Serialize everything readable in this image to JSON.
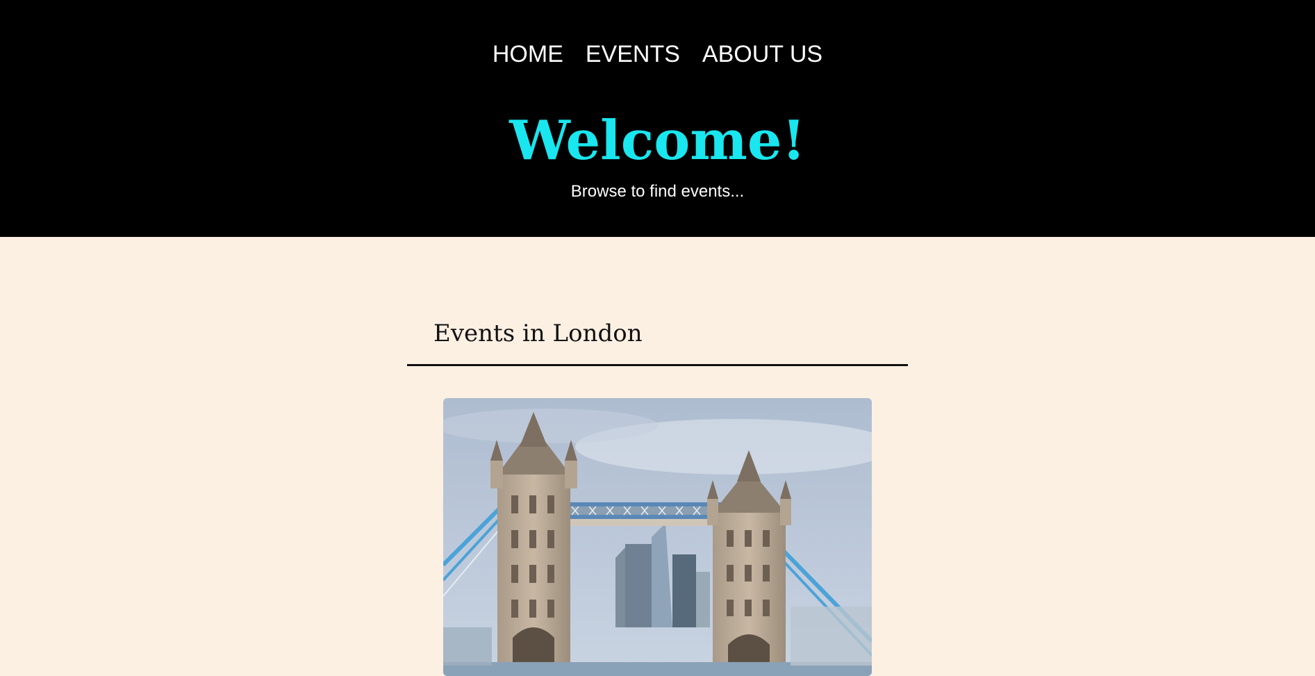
{
  "nav": {
    "items": [
      {
        "label": "HOME"
      },
      {
        "label": "EVENTS"
      },
      {
        "label": "ABOUT US"
      }
    ]
  },
  "hero": {
    "title": "Welcome!",
    "subtitle": "Browse to find events..."
  },
  "events_section": {
    "title": "Events in London"
  },
  "colors": {
    "header_bg": "#000000",
    "page_bg": "#fcf0e3",
    "accent": "#19e6ee",
    "nav_text": "#ffffff"
  }
}
